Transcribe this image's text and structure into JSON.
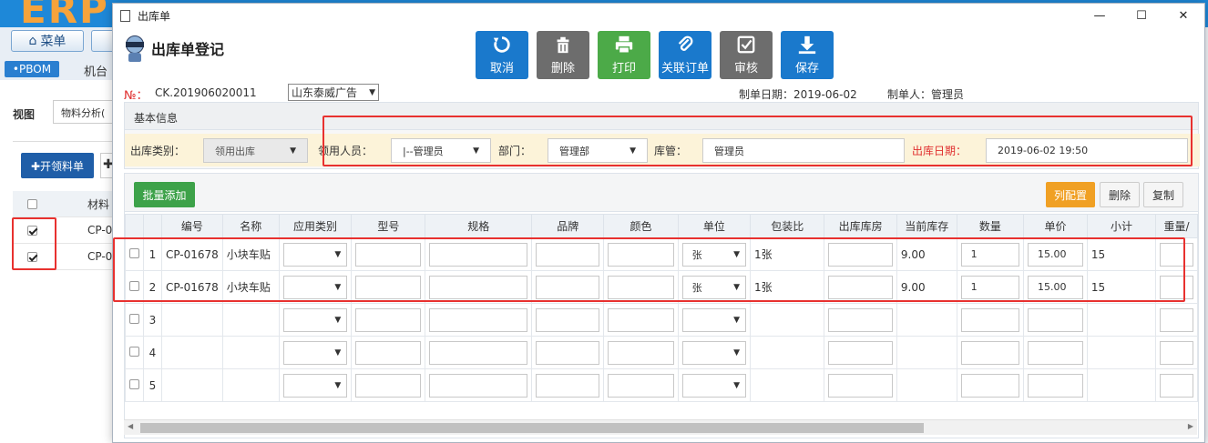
{
  "background": {
    "logo": "ERP",
    "menu_label": "菜单",
    "pbom_label": "•PBOM",
    "jitai_label": "机台",
    "view_label": "视图",
    "view_select": "物料分析(",
    "open_button": "✚开领料单",
    "plus_label": "✚",
    "table_header": "材料",
    "rows": [
      "CP-0",
      "CP-0"
    ]
  },
  "window": {
    "title": "出库单",
    "minimize": "—",
    "maximize": "☐",
    "close": "✕"
  },
  "header": {
    "title": "出库单登记",
    "no_label": "№：",
    "no_value": "CK.201906020011",
    "company": "山东泰威广告",
    "date": "制单日期：2019-06-02",
    "maker": "制单人：管理员"
  },
  "toolbar": {
    "cancel": "取消",
    "delete": "删除",
    "print": "打印",
    "link_order": "关联订单",
    "audit": "审核",
    "save": "保存"
  },
  "basic": {
    "title": "基本信息",
    "out_type_label": "出库类别：",
    "out_type_value": "领用出库",
    "receiver_label": "领用人员：",
    "receiver_value": "|--管理员",
    "dept_label": "部门：",
    "dept_value": "管理部",
    "keeper_label": "库管：",
    "keeper_value": "管理员",
    "out_date_label": "出库日期：",
    "out_date_value": "2019-06-02 19:50"
  },
  "grid": {
    "batch_add": "批量添加",
    "col_config": "列配置",
    "delete": "删除",
    "copy": "复制",
    "columns": [
      "编号",
      "名称",
      "应用类别",
      "型号",
      "规格",
      "品牌",
      "颜色",
      "单位",
      "包装比",
      "出库库房",
      "当前库存",
      "数量",
      "单价",
      "小计",
      "重量/"
    ],
    "rows": [
      {
        "n": "1",
        "code": "CP-01678",
        "name": "小块车贴",
        "unit": "张",
        "pack": "1张",
        "stock": "9.00",
        "qty": "1",
        "price": "15.00",
        "subtotal": "15"
      },
      {
        "n": "2",
        "code": "CP-01678",
        "name": "小块车贴",
        "unit": "张",
        "pack": "1张",
        "stock": "9.00",
        "qty": "1",
        "price": "15.00",
        "subtotal": "15"
      },
      {
        "n": "3",
        "code": "",
        "name": "",
        "unit": "",
        "pack": "",
        "stock": "",
        "qty": "",
        "price": "",
        "subtotal": ""
      },
      {
        "n": "4",
        "code": "",
        "name": "",
        "unit": "",
        "pack": "",
        "stock": "",
        "qty": "",
        "price": "",
        "subtotal": ""
      },
      {
        "n": "5",
        "code": "",
        "name": "",
        "unit": "",
        "pack": "",
        "stock": "",
        "qty": "",
        "price": "",
        "subtotal": ""
      }
    ]
  }
}
